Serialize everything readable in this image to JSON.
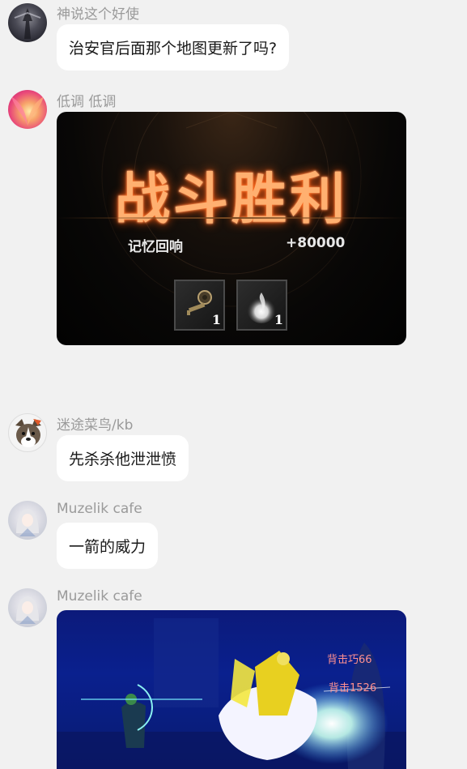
{
  "messages": [
    {
      "sender": "神说这个好使",
      "text": "治安官后面那个地图更新了吗?"
    },
    {
      "sender": "低调 低调",
      "image": {
        "title": "战斗胜利",
        "reward_label": "记忆回响",
        "reward_value": "+80000",
        "items": [
          {
            "icon": "key-icon",
            "count": "1"
          },
          {
            "icon": "flame-icon",
            "count": "1"
          }
        ]
      }
    },
    {
      "sender": "迷途菜鸟/kb",
      "text": "先杀杀他泄泄愤"
    },
    {
      "sender": "Muzelik cafe",
      "text": "一箭的威力"
    },
    {
      "sender": "Muzelik cafe",
      "image": {
        "damage_text_1": "背击巧66",
        "damage_text_2": "背击1526"
      }
    }
  ],
  "colors": {
    "background": "#f1f1f1",
    "bubble": "#ffffff",
    "name": "#9a9a9a",
    "victory_glow": "#ff6a1a"
  }
}
